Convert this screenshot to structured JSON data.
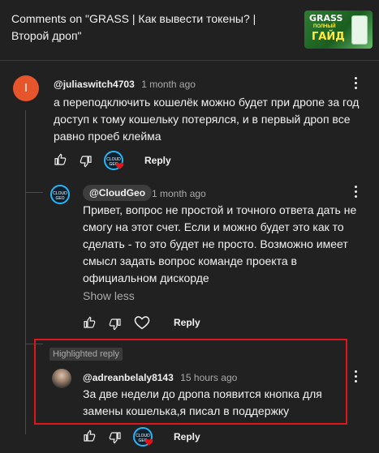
{
  "header": {
    "title": "Comments on \"GRASS | Как вывести токены? | Второй дроп\"",
    "thumbnail": {
      "line1": "GRASS",
      "line2": "ПОЛНЫЙ",
      "line3": "ГАЙД"
    }
  },
  "comments": [
    {
      "avatar_letter": "I",
      "author": "@juliaswitch4703",
      "time": "1 month ago",
      "text": "а переподключить кошелёк можно будет при дропе за год доступ к тому кошельку потерялся, и в первый дроп все равно проеб клейма",
      "reply_label": "Reply",
      "creator_avatar_text": "CLOUD GEO"
    },
    {
      "author": "@CloudGeo",
      "time": "1 month ago",
      "text": "Привет, вопрос не простой и точного ответа дать не смогу на этот счет. Если и можно будет это как то сделать - то это будет не просто. Возможно имеет смысл задать вопрос команде проекта в официальном дискорде",
      "show_less": "Show less",
      "reply_label": "Reply",
      "avatar_text": "CLOUD GEO"
    },
    {
      "highlight_badge": "Highlighted reply",
      "author": "@adreanbelaly8143",
      "time": "15 hours ago",
      "text": "За две недели до дропа появится  кнопка  для замены кошелька,я писал  в поддержку",
      "reply_label": "Reply",
      "creator_avatar_text": "CLOUD GEO"
    }
  ],
  "colors": {
    "background": "#212121",
    "highlight_border": "#e0161d",
    "heart": "#e0161d",
    "avatar_orange": "#e6552b"
  },
  "icons": [
    "thumb-up-icon",
    "thumb-down-icon",
    "heart-icon",
    "more-vert-icon"
  ]
}
